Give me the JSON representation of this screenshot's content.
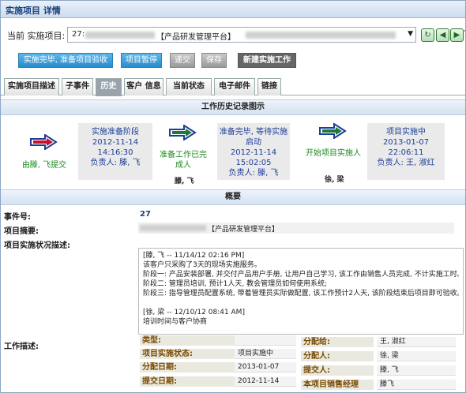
{
  "window": {
    "title": "实施项目 详情"
  },
  "project": {
    "label": "当前 实施项目:",
    "id": "27:",
    "selected_name": "【产品研发管理平台】"
  },
  "nav": {
    "refresh_icon": "refresh-icon",
    "prev_icon": "prev-icon",
    "next_icon": "next-icon",
    "help": "?"
  },
  "actions": {
    "complete": "实施完毕, 准备项目验收",
    "pause": "项目暂停",
    "submit": "递交",
    "save": "保存",
    "new": "新建实施工作"
  },
  "tabs": [
    "实施项目描述",
    "子事件",
    "历史",
    "客户 信息",
    "当前状态",
    "电子邮件",
    "链接"
  ],
  "history": {
    "heading": "工作历史记录图示",
    "start_label": "由滕, 飞提交",
    "stage1": {
      "name": "实施准备阶段",
      "time": "2012-11-14 14:16:30",
      "owner": "负责人: 滕, 飞"
    },
    "trans1": {
      "label": "准备工作已完成人",
      "person": "滕, 飞"
    },
    "stage2": {
      "name": "准备完毕, 等待实施启动",
      "time": "2012-11-14 15:02:05",
      "owner": "负责人: 滕, 飞"
    },
    "trans2": {
      "label": "开始项目实施人",
      "person": "徐, 梁"
    },
    "stage3": {
      "name": "项目实施中",
      "time": "2013-01-07 22:06:11",
      "owner": "负责人: 王, 淑红"
    }
  },
  "summary": {
    "heading": "概要",
    "event_no_label": "事件号:",
    "event_no": "27",
    "project_summary_label": "项目摘要:",
    "project_summary": "【产品研发管理平台】",
    "status_desc_label": "项目实施状况描述:",
    "status_desc_lines": [
      "[滕, 飞 -- 11/14/12 02:16 PM]",
      "该客户只采购了3天的现场实施服务。",
      "阶段一: 产品安装部署, 并交付产品用户手册, 让用户自己学习, 该工作由销售人员完成, 不计实施工时。",
      "阶段二: 管理员培训, 预计1人天, 教会管理员如何使用系统;",
      "阶段三: 指导管理员配置系统, 带着管理员实际做配置, 该工作预计2人天, 该阶段结束后项目即可验收。",
      "",
      "[徐, 梁 -- 12/10/12 08:41 AM]",
      "培训时间与客户协商"
    ],
    "work_desc_label": "工作描述:"
  },
  "work": {
    "type_label": "类型:",
    "type_value": "",
    "assign_to_label": "分配给:",
    "assign_to_value": "王, 淑红",
    "status_label": "项目实施状态:",
    "status_value": "项目实施中",
    "assigner_label": "分配人:",
    "assigner_value": "徐, 梁",
    "assign_date_label": "分配日期:",
    "assign_date_value": "2013-01-07",
    "submitter_label": "提交人:",
    "submitter_value": "滕, 飞",
    "submit_date_label": "提交日期:",
    "submit_date_value": "2012-11-14",
    "sales_manager_label": "本项目销售经理",
    "sales_manager_value": "滕飞"
  },
  "colors": {
    "accent": "#2a8bcc",
    "arrow_red": "#c8102e",
    "arrow_green": "#1f7a3a",
    "arrow_blue": "#1c3e9a",
    "link_blue": "#1c3e9a",
    "green_text": "#1f8a1f"
  }
}
